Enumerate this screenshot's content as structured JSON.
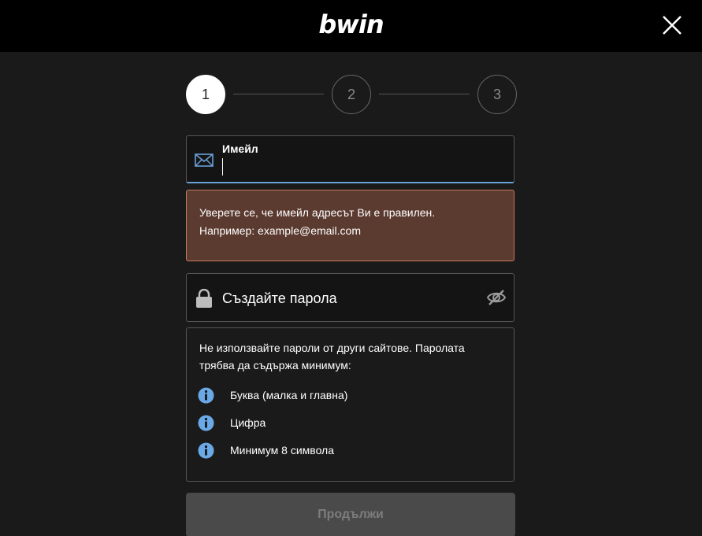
{
  "header": {
    "logo_text": "bwin"
  },
  "stepper": {
    "steps": [
      "1",
      "2",
      "3"
    ],
    "active_step": 1
  },
  "email": {
    "label": "Имейл",
    "value": ""
  },
  "error": {
    "line1": "Уверете се, че имейл адресът Ви е правилен.",
    "line2": "Например: example@email.com"
  },
  "password": {
    "placeholder": "Създайте парола",
    "value": ""
  },
  "rules": {
    "intro": "Не използвайте пароли от други сайтове. Паролата трябва да съдържа минимум:",
    "items": [
      "Буква (малка и главна)",
      "Цифра",
      "Минимум 8 символа"
    ]
  },
  "actions": {
    "continue_label": "Продължи"
  },
  "colors": {
    "accent": "#6aa1d9",
    "error_bg": "#5b3a30",
    "error_border": "#c77a5a",
    "info_icon": "#6aa8e6"
  },
  "icons": [
    "close-icon",
    "envelope-icon",
    "lock-icon",
    "eye-off-icon",
    "info-icon"
  ]
}
